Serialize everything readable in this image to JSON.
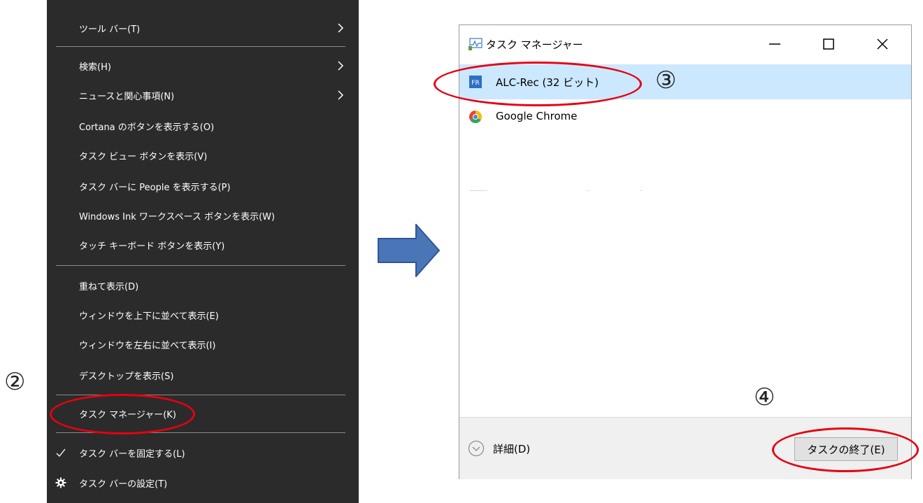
{
  "context_menu": {
    "items": [
      {
        "label": "ツール バー(T)"
      },
      {
        "label": "検索(H)"
      },
      {
        "label": "ニュースと関心事項(N)"
      },
      {
        "label": "Cortana のボタンを表示する(O)"
      },
      {
        "label": "タスク ビュー ボタンを表示(V)"
      },
      {
        "label": "タスク バーに People を表示する(P)"
      },
      {
        "label": "Windows Ink ワークスペース ボタンを表示(W)"
      },
      {
        "label": "タッチ キーボード ボタンを表示(Y)"
      },
      {
        "label": "重ねて表示(D)"
      },
      {
        "label": "ウィンドウを上下に並べて表示(E)"
      },
      {
        "label": "ウィンドウを左右に並べて表示(I)"
      },
      {
        "label": "デスクトップを表示(S)"
      },
      {
        "label": "タスク マネージャー(K)"
      },
      {
        "label": "タスク バーを固定する(L)"
      },
      {
        "label": "タスク バーの設定(T)"
      }
    ]
  },
  "annotations": {
    "step2": "②",
    "step3": "③",
    "step4": "④"
  },
  "task_manager": {
    "title": "タスク マネージャー",
    "apps": [
      {
        "label": "ALC-Rec (32 ビット)",
        "icon": "alc-rec-app-icon",
        "selected": true
      },
      {
        "label": "Google Chrome",
        "icon": "chrome-icon",
        "selected": false
      }
    ],
    "details_label": "詳細(D)",
    "end_task_label": "タスクの終了(E)"
  },
  "colors": {
    "menu_bg": "#2b2b2b",
    "highlight_oval": "#e60012",
    "arrow": "#4a76b8",
    "selected_row": "#cce8ff"
  }
}
